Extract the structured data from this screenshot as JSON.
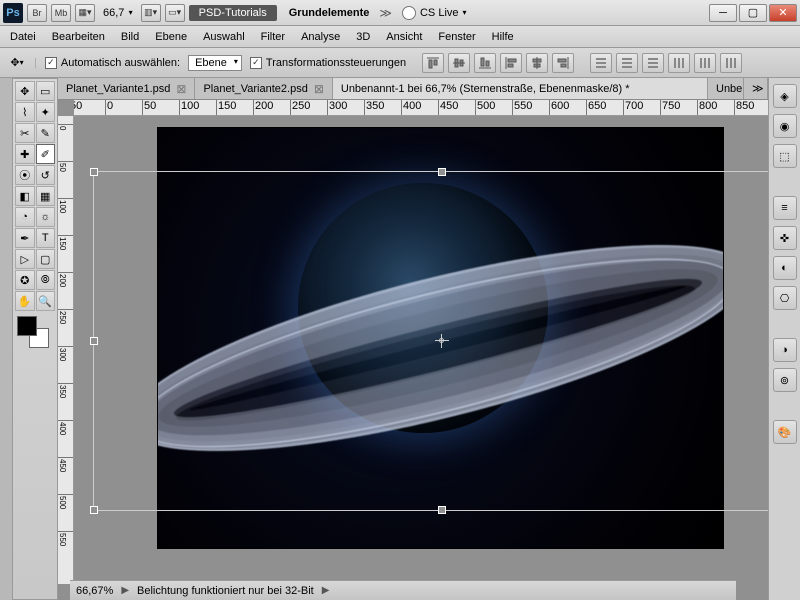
{
  "title": {
    "zoom": "66,7",
    "psd_tut": "PSD-Tutorials",
    "grund": "Grundelemente",
    "cslive": "CS Live"
  },
  "menu": [
    "Datei",
    "Bearbeiten",
    "Bild",
    "Ebene",
    "Auswahl",
    "Filter",
    "Analyse",
    "3D",
    "Ansicht",
    "Fenster",
    "Hilfe"
  ],
  "opt": {
    "auto": "Automatisch auswählen:",
    "ebene": "Ebene",
    "trans": "Transformationssteuerungen"
  },
  "tabs": [
    {
      "label": "Planet_Variante1.psd",
      "active": false
    },
    {
      "label": "Planet_Variante2.psd",
      "active": false
    },
    {
      "label": "Unbenannt-1 bei 66,7% (Sternenstraße, Ebenenmaske/8) *",
      "active": true
    },
    {
      "label": "Unbe",
      "active": false
    }
  ],
  "ruler_h": [
    "50",
    "0",
    "50",
    "100",
    "150",
    "200",
    "250",
    "300",
    "350",
    "400",
    "450",
    "500",
    "550",
    "600",
    "650",
    "700",
    "750",
    "800",
    "850"
  ],
  "ruler_v": [
    "0",
    "50",
    "100",
    "150",
    "200",
    "250",
    "300",
    "350",
    "400",
    "450",
    "500",
    "550"
  ],
  "status": {
    "zoom": "66,67%",
    "msg": "Belichtung funktioniert nur bei 32-Bit"
  }
}
